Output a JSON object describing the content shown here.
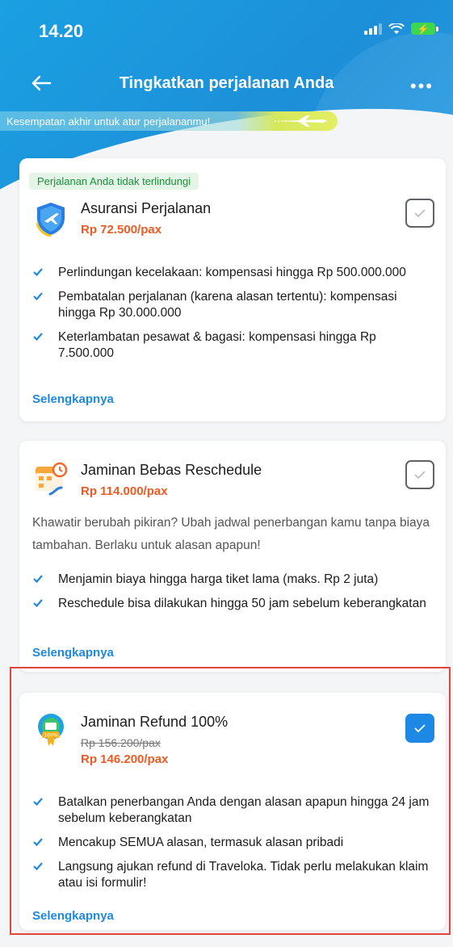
{
  "status_bar": {
    "time": "14.20"
  },
  "header": {
    "title": "Tingkatkan perjalanan Anda",
    "more_label": "•••"
  },
  "banner": {
    "text": "Kesempatan akhir untuk atur perjalananmu!"
  },
  "colors": {
    "accent": "#1e88e5",
    "price": "#f05a22",
    "protection_tag": "#1a8f3a",
    "highlight": "#e2463a"
  },
  "cards": [
    {
      "tag": "Perjalanan Anda tidak terlindungi",
      "icon": "airplane-shield-icon",
      "name": "Asuransi Perjalanan",
      "price": "Rp 72.500/pax",
      "checked": false,
      "bullets": [
        "Perlindungan kecelakaan: kompensasi hingga Rp 500.000.000",
        "Pembatalan perjalanan (karena alasan tertentu): kompensasi hingga Rp 30.000.000",
        "Keterlambatan pesawat & bagasi: kompensasi hingga Rp 7.500.000"
      ],
      "more_label": "Selengkapnya"
    },
    {
      "icon": "calendar-reschedule-icon",
      "name": "Jaminan Bebas Reschedule",
      "price": "Rp 114.000/pax",
      "checked": false,
      "description": "Khawatir berubah pikiran? Ubah jadwal penerbangan kamu tanpa biaya tambahan. Berlaku untuk alasan apapun!",
      "bullets": [
        "Menjamin biaya hingga harga tiket lama (maks. Rp 2 juta)",
        "Reschedule bisa dilakukan hingga 50 jam sebelum keberangkatan"
      ],
      "more_label": "Selengkapnya"
    },
    {
      "icon": "refund-badge-icon",
      "name": "Jaminan Refund 100%",
      "old_price": "Rp 156.200/pax",
      "price": "Rp 146.200/pax",
      "checked": true,
      "bullets": [
        "Batalkan penerbangan Anda dengan alasan apapun hingga 24 jam sebelum keberangkatan",
        "Mencakup SEMUA alasan, termasuk alasan pribadi",
        "Langsung ajukan refund di Traveloka. Tidak perlu melakukan klaim atau isi formulir!"
      ],
      "more_label": "Selengkapnya"
    }
  ]
}
